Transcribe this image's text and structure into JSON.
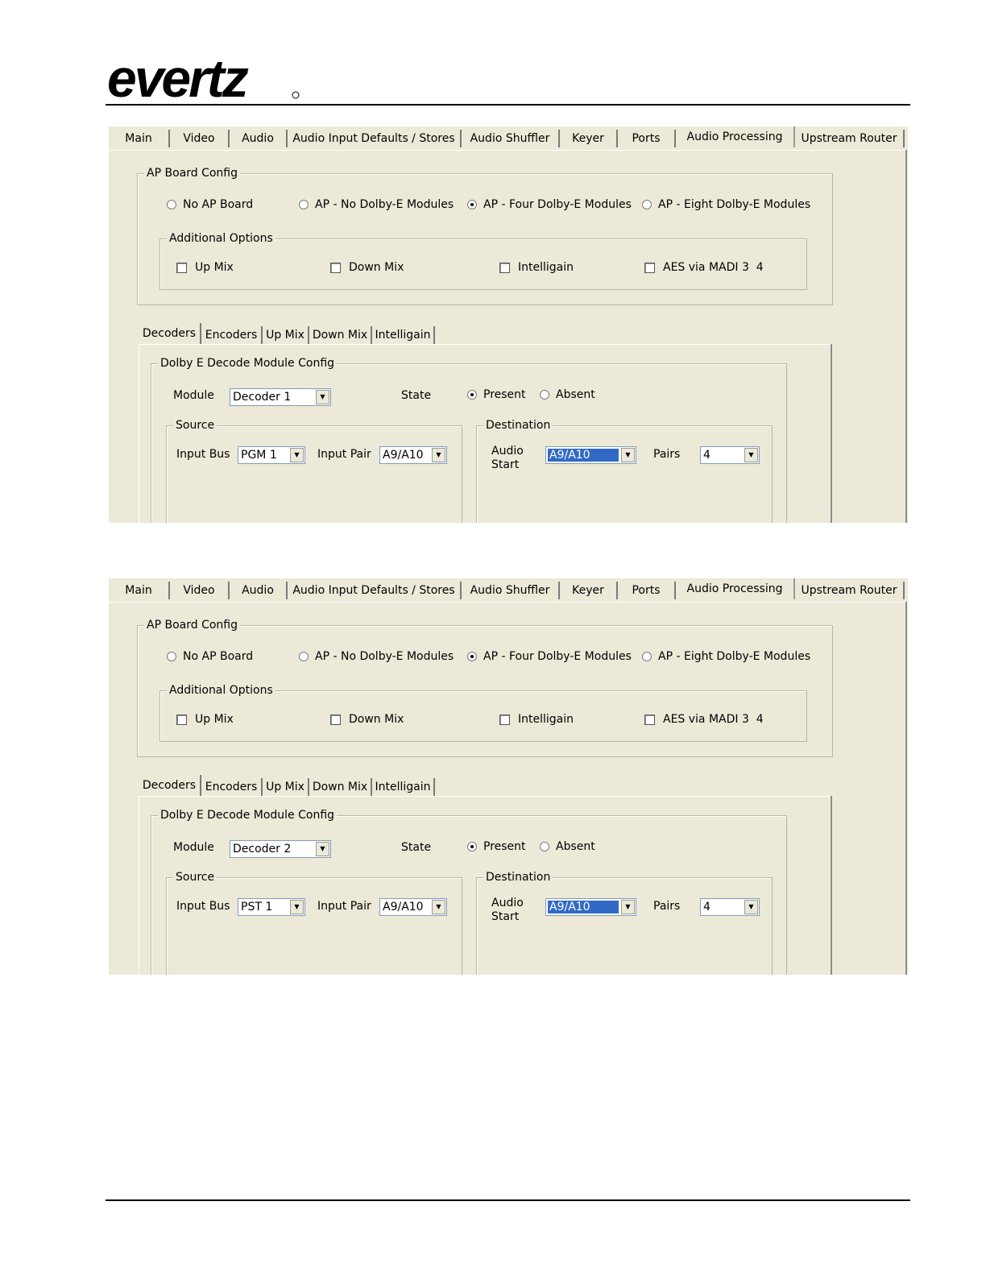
{
  "header": {
    "logo_text": "evertz"
  },
  "screens": [
    {
      "tabs": [
        "Main",
        "Video",
        "Audio",
        "Audio Input Defaults / Stores",
        "Audio Shuffler",
        "Keyer",
        "Ports",
        "Audio Processing",
        "Upstream Router"
      ],
      "selected_tab": "Audio Processing",
      "ap_board_config": {
        "legend": "AP Board Config",
        "options": [
          "No AP Board",
          "AP - No Dolby-E Modules",
          "AP - Four Dolby-E Modules",
          "AP - Eight Dolby-E Modules"
        ],
        "selected": "AP - Four Dolby-E Modules",
        "additional_options": {
          "legend": "Additional Options",
          "checkboxes": [
            "Up Mix",
            "Down Mix",
            "Intelligain",
            "AES via MADI 3  4"
          ]
        }
      },
      "subtabs": [
        "Decoders",
        "Encoders",
        "Up Mix",
        "Down Mix",
        "Intelligain"
      ],
      "selected_subtab": "Decoders",
      "decode_config": {
        "legend": "Dolby E Decode Module Config",
        "module_label": "Module",
        "module_value": "Decoder 1",
        "state_label": "State",
        "state_options": [
          "Present",
          "Absent"
        ],
        "state_selected": "Present",
        "source": {
          "legend": "Source",
          "input_bus_label": "Input Bus",
          "input_bus_value": "PGM 1",
          "input_pair_label": "Input Pair",
          "input_pair_value": "A9/A10"
        },
        "destination": {
          "legend": "Destination",
          "audio_label": "Audio",
          "start_label": "Start",
          "audio_start_value": "A9/A10",
          "pairs_label": "Pairs",
          "pairs_value": "4"
        }
      }
    },
    {
      "tabs": [
        "Main",
        "Video",
        "Audio",
        "Audio Input Defaults / Stores",
        "Audio Shuffler",
        "Keyer",
        "Ports",
        "Audio Processing",
        "Upstream Router"
      ],
      "selected_tab": "Audio Processing",
      "ap_board_config": {
        "legend": "AP Board Config",
        "options": [
          "No AP Board",
          "AP - No Dolby-E Modules",
          "AP - Four Dolby-E Modules",
          "AP - Eight Dolby-E Modules"
        ],
        "selected": "AP - Four Dolby-E Modules",
        "additional_options": {
          "legend": "Additional Options",
          "checkboxes": [
            "Up Mix",
            "Down Mix",
            "Intelligain",
            "AES via MADI 3  4"
          ]
        }
      },
      "subtabs": [
        "Decoders",
        "Encoders",
        "Up Mix",
        "Down Mix",
        "Intelligain"
      ],
      "selected_subtab": "Decoders",
      "decode_config": {
        "legend": "Dolby E Decode Module Config",
        "module_label": "Module",
        "module_value": "Decoder 2",
        "state_label": "State",
        "state_options": [
          "Present",
          "Absent"
        ],
        "state_selected": "Present",
        "source": {
          "legend": "Source",
          "input_bus_label": "Input Bus",
          "input_bus_value": "PST 1",
          "input_pair_label": "Input Pair",
          "input_pair_value": "A9/A10"
        },
        "destination": {
          "legend": "Destination",
          "audio_label": "Audio",
          "start_label": "Start",
          "audio_start_value": "A9/A10",
          "pairs_value": "4",
          "pairs_label": "Pairs"
        }
      }
    }
  ]
}
